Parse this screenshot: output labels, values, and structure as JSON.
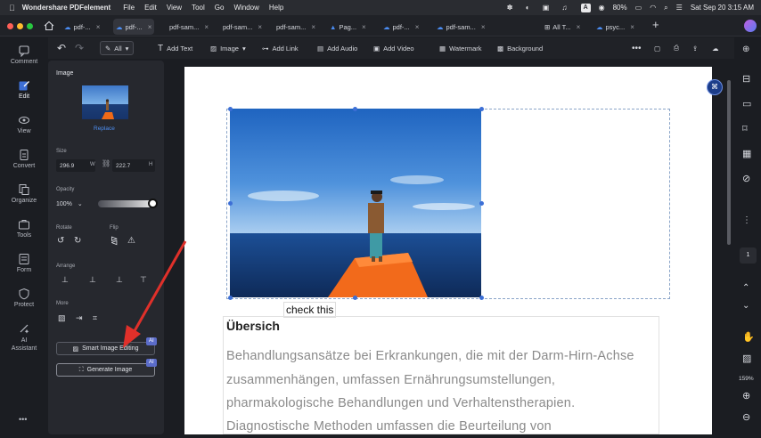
{
  "menubar": {
    "app_name": "Wondershare PDFelement",
    "menus": [
      "File",
      "Edit",
      "View",
      "Tool",
      "Go",
      "Window",
      "Help"
    ],
    "battery": "80%",
    "datetime": "Sat Sep 20  3:15 AM",
    "input_badge": "A"
  },
  "tabs": [
    {
      "label": "pdf-..."
    },
    {
      "label": "pdf-..."
    },
    {
      "label": "pdf-sam..."
    },
    {
      "label": "pdf-sam..."
    },
    {
      "label": "pdf-sam..."
    },
    {
      "label": "Pag..."
    },
    {
      "label": "pdf-..."
    },
    {
      "label": "pdf-sam..."
    },
    {
      "label": "All T..."
    },
    {
      "label": "psyc..."
    }
  ],
  "toolbar": {
    "all_label": "All",
    "add_text": "Add Text",
    "image": "Image",
    "add_link": "Add Link",
    "add_audio": "Add Audio",
    "add_video": "Add Video",
    "watermark": "Watermark",
    "background": "Background"
  },
  "rail": [
    {
      "label": "Comment"
    },
    {
      "label": "Edit"
    },
    {
      "label": "View"
    },
    {
      "label": "Convert"
    },
    {
      "label": "Organize"
    },
    {
      "label": "Tools"
    },
    {
      "label": "Form"
    },
    {
      "label": "Protect"
    },
    {
      "label": "AI Assistant"
    }
  ],
  "panel": {
    "title": "Image",
    "replace": "Replace",
    "size_label": "Size",
    "width": "296.9",
    "width_unit": "W",
    "height": "222.7",
    "height_unit": "H",
    "opacity_label": "Opacity",
    "opacity_value": "100%",
    "opacity_fraction": 1.0,
    "rotate_label": "Rotate",
    "flip_label": "Flip",
    "arrange_label": "Arrange",
    "more_label": "More",
    "smart_editing": "Smart Image Editing",
    "generate_image": "Generate Image",
    "ai_badge": "AI"
  },
  "document": {
    "check_label": "check this",
    "heading": "Übersich",
    "lines": [
      "Behandlungsansätze bei Erkrankungen, die mit der Darm-Hirn-Achse",
      "zusammenhängen, umfassen Ernährungsumstellungen,",
      "pharmakologische Behandlungen und Verhaltenstherapien.",
      "Diagnostische Methoden umfassen die Beurteilung von"
    ]
  },
  "right_rail": {
    "page_number": "1",
    "zoom": "159%"
  },
  "colors": {
    "accent": "#3d6fd6",
    "arrow": "#e0302a",
    "ai_badge": "#5b6cc9"
  }
}
